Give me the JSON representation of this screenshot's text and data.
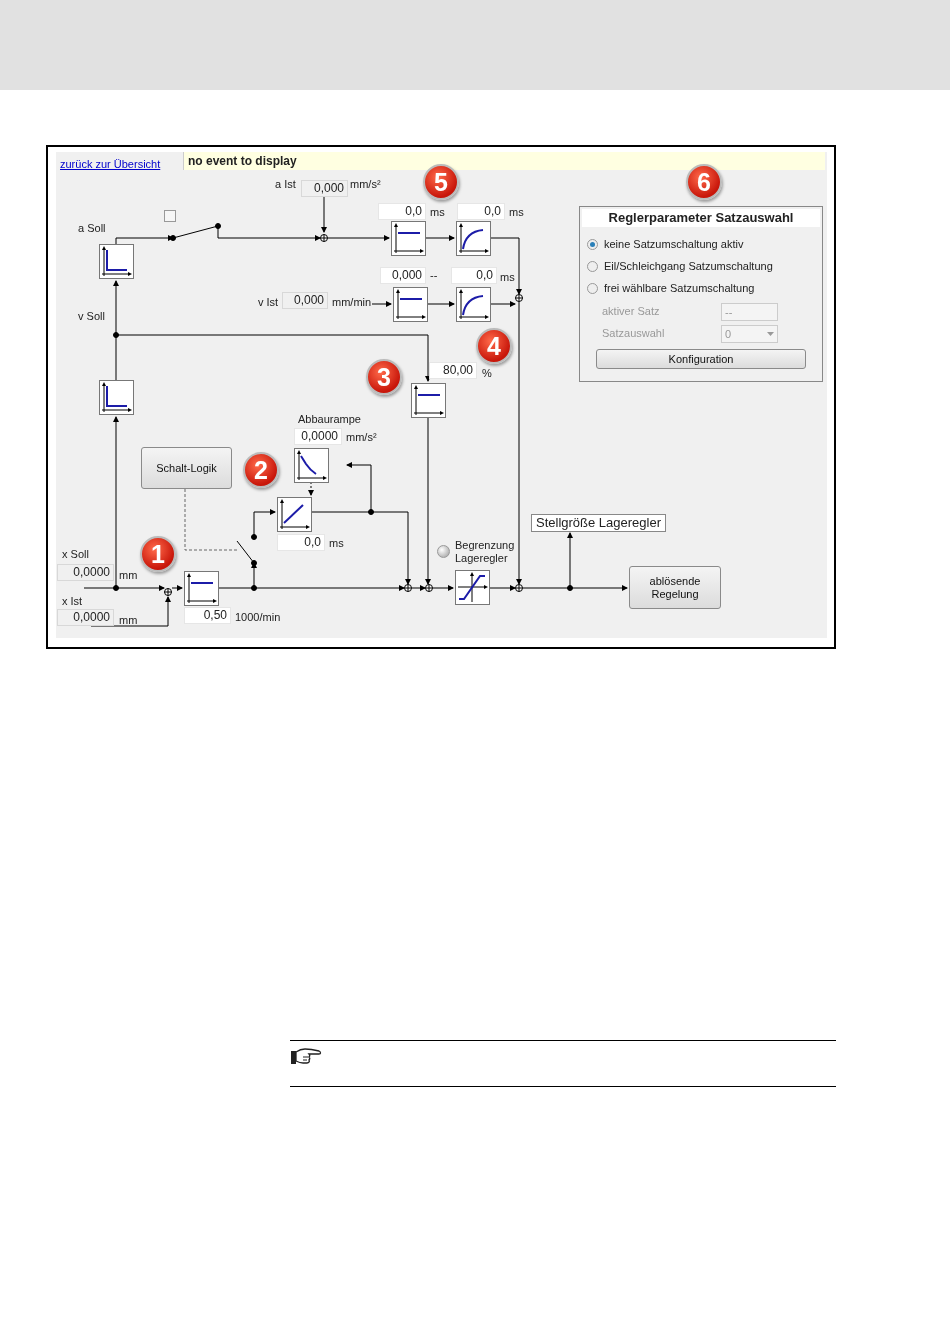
{
  "link": "zurück zur Übersicht",
  "event_bar": "no event to display",
  "markers": [
    "1",
    "2",
    "3",
    "4",
    "5",
    "6"
  ],
  "signal_labels": [
    "a Soll",
    "v Soll"
  ],
  "switch_checkbox": {
    "checked": false
  },
  "fields": [
    {
      "kind": "display",
      "label": "a Ist",
      "value": "0,000",
      "unit": "mm/s²"
    },
    {
      "kind": "input",
      "value": "0,0",
      "unit": "ms"
    },
    {
      "kind": "input",
      "value": "0,0",
      "unit": "ms"
    },
    {
      "kind": "input",
      "value": "0,000",
      "unit": "--"
    },
    {
      "kind": "input",
      "value": "0,0",
      "unit": "ms"
    },
    {
      "kind": "display",
      "label": "v Ist",
      "value": "0,000",
      "unit": "mm/min"
    },
    {
      "kind": "input",
      "value": "80,00",
      "unit": "%"
    },
    {
      "kind": "input",
      "label": "Abbaurampe",
      "value": "0,0000",
      "unit": "mm/s²"
    },
    {
      "kind": "input",
      "value": "0,0",
      "unit": "ms"
    },
    {
      "kind": "display",
      "label": "x Soll",
      "value": "0,0000",
      "unit": "mm"
    },
    {
      "kind": "display",
      "label": "x Ist",
      "value": "0,0000",
      "unit": "mm"
    },
    {
      "kind": "input",
      "value": "0,50",
      "unit": "1000/min"
    }
  ],
  "logic_button": "Schalt-Logik",
  "limit_indicator": {
    "label": "Begrenzung\nLageregler",
    "on": false
  },
  "output_label": "Stellgröße Lageregler",
  "output_button": "ablösende\nRegelung",
  "settings": {
    "title": "Reglerparameter Satzauswahl",
    "options": [
      {
        "label": "keine Satzumschaltung aktiv",
        "selected": true
      },
      {
        "label": "Eil/Schleichgang Satzumschaltung",
        "selected": false
      },
      {
        "label": "frei wählbare Satzumschaltung",
        "selected": false
      }
    ],
    "active_set": {
      "label": "aktiver Satz",
      "value": "--",
      "disabled": true
    },
    "set_select": {
      "label": "Satzauswahl",
      "value": "0",
      "disabled": true
    },
    "button": "Konfiguration"
  }
}
